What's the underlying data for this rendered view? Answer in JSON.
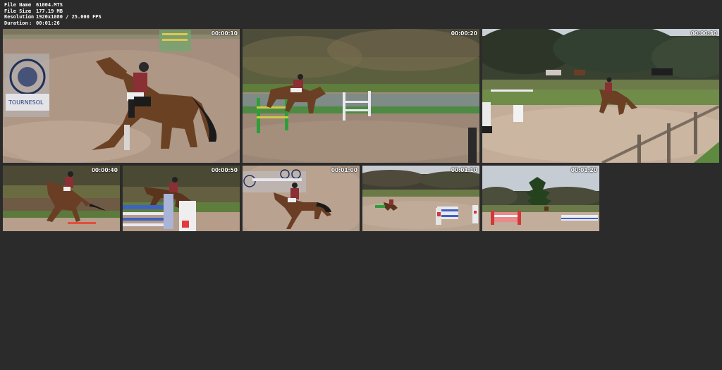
{
  "file_info": {
    "name_label": "File Name",
    "name_value": "61004.MTS",
    "size_label": "File Size",
    "size_value": "177.19 MB",
    "resolution_label": "Resolution",
    "resolution_value": "1920x1080 / 25.000 FPS",
    "duration_label": "Duration",
    "duration_value": "00:01:26",
    "separator": ":"
  },
  "thumbnails": [
    {
      "timestamp": "00:00:10"
    },
    {
      "timestamp": "00:00:20"
    },
    {
      "timestamp": "00:00:30"
    },
    {
      "timestamp": "00:00:40"
    },
    {
      "timestamp": "00:00:50"
    },
    {
      "timestamp": "00:01:00"
    },
    {
      "timestamp": "00:01:10"
    },
    {
      "timestamp": "00:01:20"
    }
  ],
  "sign_text": "TOURNESOL"
}
